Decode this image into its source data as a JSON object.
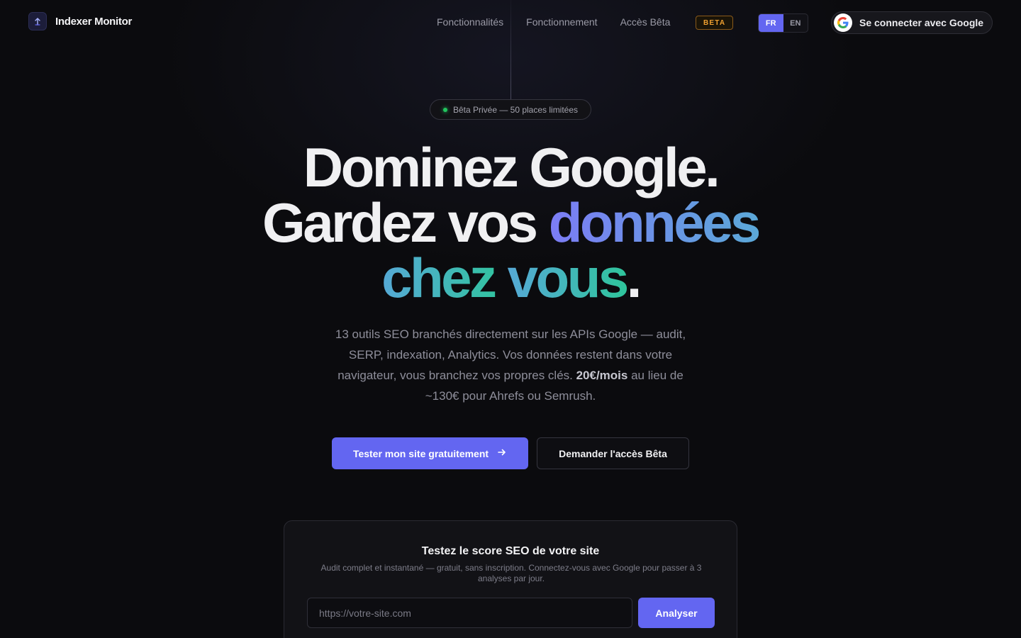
{
  "brand": {
    "name": "Indexer Monitor"
  },
  "nav": {
    "links": [
      "Fonctionnalités",
      "Fonctionnement",
      "Accès Bêta"
    ],
    "beta_badge": "BETA",
    "lang": {
      "active": "FR",
      "inactive": "EN"
    },
    "google_button": "Se connecter avec Google"
  },
  "hero": {
    "pill": "Bêta Privée — 50 places limitées",
    "headline": {
      "line1": "Dominez Google.",
      "line2_a": "Gardez vos ",
      "line2_b": "données",
      "line3_a": "chez ",
      "line3_b": "vous",
      "line3_c": "."
    },
    "subtext_a": "13 outils SEO branchés directement sur les APIs Google — audit, SERP, indexation, Analytics. Vos données restent dans votre navigateur, vous branchez vos propres clés. ",
    "subtext_price": "20€/mois",
    "subtext_b": " au lieu de ~130€ pour Ahrefs ou Semrush.",
    "cta_primary": "Tester mon site gratuitement",
    "cta_secondary": "Demander l'accès Bêta"
  },
  "audit_card": {
    "title": "Testez le score SEO de votre site",
    "description": "Audit complet et instantané — gratuit, sans inscription. Connectez-vous avec Google pour passer à 3 analyses par jour.",
    "input_placeholder": "https://votre-site.com",
    "button": "Analyser"
  },
  "colors": {
    "accent": "#6366f1",
    "beta": "#f0a030",
    "status_dot": "#22c55e",
    "gradient_start": "#7c7cf5",
    "gradient_mid": "#56a9d6",
    "gradient_end": "#2fc59c"
  },
  "icons": {
    "logo": "upload-arrow-icon",
    "google": "google-g-icon",
    "cta_arrow": "arrow-right-icon"
  }
}
